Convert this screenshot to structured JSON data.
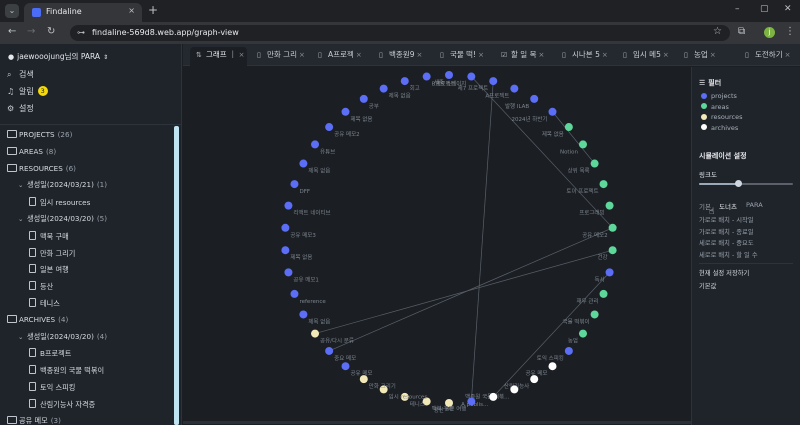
{
  "browser": {
    "tab_title": "Findaline",
    "tab_close": "×",
    "new_tab": "+",
    "tabs_menu": "⌄",
    "url": "findaline-569d8.web.app/graph-view",
    "profile_initial": "j",
    "window_controls": [
      "–",
      "▢",
      "✕"
    ]
  },
  "sidebar": {
    "workspace": "jaewooojung님의 PARA",
    "search": "검색",
    "alerts": "알림",
    "alerts_count": "3",
    "settings": "설정",
    "tree": [
      {
        "kind": "folder",
        "label": "PROJECTS",
        "count": "(26)",
        "indent": 0
      },
      {
        "kind": "folder",
        "label": "AREAS",
        "count": "(8)",
        "indent": 0
      },
      {
        "kind": "folder",
        "label": "RESOURCES",
        "count": "(6)",
        "indent": 0
      },
      {
        "kind": "group",
        "label": "생성일(2024/03/21)",
        "count": "(1)",
        "indent": 1
      },
      {
        "kind": "doc",
        "label": "임시 resources",
        "count": "",
        "indent": 2
      },
      {
        "kind": "group",
        "label": "생성일(2024/03/20)",
        "count": "(5)",
        "indent": 1
      },
      {
        "kind": "doc",
        "label": "맥북 구매",
        "count": "",
        "indent": 2
      },
      {
        "kind": "doc",
        "label": "만화 그리기",
        "count": "",
        "indent": 2
      },
      {
        "kind": "doc",
        "label": "일본 여행",
        "count": "",
        "indent": 2
      },
      {
        "kind": "doc",
        "label": "등산",
        "count": "",
        "indent": 2
      },
      {
        "kind": "doc",
        "label": "테니스",
        "count": "",
        "indent": 2
      },
      {
        "kind": "folder",
        "label": "ARCHIVES",
        "count": "(4)",
        "indent": 0
      },
      {
        "kind": "group",
        "label": "생성일(2024/03/20)",
        "count": "(4)",
        "indent": 1
      },
      {
        "kind": "doc",
        "label": "B프로젝트",
        "count": "",
        "indent": 2
      },
      {
        "kind": "doc",
        "label": "백종원의 국물 떡볶이",
        "count": "",
        "indent": 2
      },
      {
        "kind": "doc",
        "label": "토익 스피킹",
        "count": "",
        "indent": 2
      },
      {
        "kind": "doc",
        "label": "산림기능사 자격증",
        "count": "",
        "indent": 2
      },
      {
        "kind": "folder",
        "label": "공유 메모",
        "count": "(3)",
        "indent": 0
      }
    ]
  },
  "doc_tabs": [
    {
      "label": "그래프 ｜",
      "icon": "⇅",
      "active": true
    },
    {
      "label": "만화 그리",
      "icon": "▯",
      "active": false
    },
    {
      "label": "A프로젝",
      "icon": "▯",
      "active": false
    },
    {
      "label": "백종원9",
      "icon": "▯",
      "active": false
    },
    {
      "label": "국물 떡!",
      "icon": "▯",
      "active": false
    },
    {
      "label": "할 일 목",
      "icon": "☑",
      "active": false
    },
    {
      "label": "시나본 5",
      "icon": "▯",
      "active": false
    },
    {
      "label": "임시 메5",
      "icon": "▯",
      "active": false
    },
    {
      "label": "농업",
      "icon": "▯",
      "active": false
    },
    {
      "label": "도전하기",
      "icon": "▯",
      "active": false
    }
  ],
  "graph": {
    "colors": {
      "projects": "#5b6ef5",
      "areas": "#5ed89a",
      "resources": "#f3e8b8",
      "archives": "#ffffff"
    },
    "nodes": [
      {
        "label": "세주",
        "type": "projects"
      },
      {
        "label": "제5 스테이지",
        "type": "projects"
      },
      {
        "label": "제7 프로젝트",
        "type": "projects"
      },
      {
        "label": "A프로젝트",
        "type": "projects"
      },
      {
        "label": "발행 ILAB",
        "type": "projects"
      },
      {
        "label": "2024년 하반기",
        "type": "projects"
      },
      {
        "label": "제목 없음",
        "type": "areas"
      },
      {
        "label": "Notion",
        "type": "areas"
      },
      {
        "label": "상위 목록",
        "type": "areas"
      },
      {
        "label": "토이 프로젝트",
        "type": "areas"
      },
      {
        "label": "프로그래밍",
        "type": "areas"
      },
      {
        "label": "공유 메모2",
        "type": "areas"
      },
      {
        "label": "건강",
        "type": "areas"
      },
      {
        "label": "독서",
        "type": "projects"
      },
      {
        "label": "재무 관리",
        "type": "areas"
      },
      {
        "label": "국물 떡볶이",
        "type": "areas"
      },
      {
        "label": "농업",
        "type": "areas"
      },
      {
        "label": "토익 스피킹",
        "type": "projects"
      },
      {
        "label": "공유 메모",
        "type": "archives"
      },
      {
        "label": "산림기능사",
        "type": "archives"
      },
      {
        "label": "백종원 국물 떡볶...",
        "type": "archives"
      },
      {
        "label": "A publis...",
        "type": "archives"
      },
      {
        "label": "일본 여행",
        "type": "projects"
      },
      {
        "label": "등산",
        "type": "resources"
      },
      {
        "label": "맥북 구매",
        "type": "resources"
      },
      {
        "label": "테니스",
        "type": "resources"
      },
      {
        "label": "임시 resources",
        "type": "resources"
      },
      {
        "label": "만화 그리기",
        "type": "resources"
      },
      {
        "label": "공유 메모",
        "type": "projects"
      },
      {
        "label": "중요 메모",
        "type": "projects"
      },
      {
        "label": "공유/다시 분류",
        "type": "resources"
      },
      {
        "label": "제목 없음",
        "type": "projects"
      },
      {
        "label": "reference",
        "type": "projects"
      },
      {
        "label": "공유 메모1",
        "type": "projects"
      },
      {
        "label": "제목 없음",
        "type": "projects"
      },
      {
        "label": "공유 메모3",
        "type": "projects"
      },
      {
        "label": "리액트 네이티브",
        "type": "projects"
      },
      {
        "label": "DFF",
        "type": "projects"
      },
      {
        "label": "제목 없음",
        "type": "projects"
      },
      {
        "label": "유튜브",
        "type": "projects"
      },
      {
        "label": "공유 메모2",
        "type": "projects"
      },
      {
        "label": "제목 없음",
        "type": "projects"
      },
      {
        "label": "공부",
        "type": "projects"
      },
      {
        "label": "제목 없음",
        "type": "projects"
      },
      {
        "label": "회고",
        "type": "projects"
      },
      {
        "label": "B프로젝트",
        "type": "projects"
      }
    ],
    "links": [
      [
        1,
        11
      ],
      [
        2,
        22
      ],
      [
        11,
        29
      ],
      [
        12,
        30
      ],
      [
        13,
        21
      ],
      [
        5,
        8
      ]
    ]
  },
  "right_panel": {
    "filter_title": "필터",
    "legend": [
      {
        "label": "projects",
        "color": "#5b6ef5"
      },
      {
        "label": "areas",
        "color": "#5ed89a"
      },
      {
        "label": "resources",
        "color": "#f3e8b8"
      },
      {
        "label": "archives",
        "color": "#ffffff"
      }
    ],
    "sim_title": "시뮬레이션 설정",
    "link_distance_label": "링크도",
    "link_distance_value": 0.42,
    "layout_options": [
      "기본",
      "도너츠",
      "PARA"
    ],
    "layout_selected": "도너츠",
    "sort_options": [
      "가로로 배치 - 시작일",
      "가로로 배치 - 종료일",
      "세로로 배치 - 중요도",
      "세로로 배치 - 할 일 수"
    ],
    "save_setting": "현재 설정 저장하기",
    "default_value": "기본값"
  }
}
